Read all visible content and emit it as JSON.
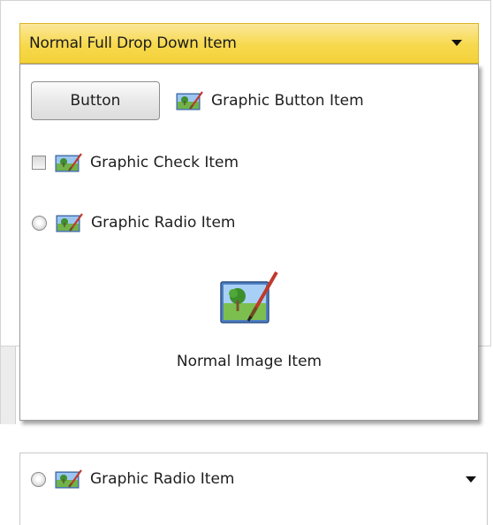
{
  "dropdown_top": {
    "label": "Normal Full Drop Down Item",
    "arrow_icon": "chevron-down-icon",
    "accent_color": "#f6d743"
  },
  "popup": {
    "button_label": "Button",
    "graphic_button_item": {
      "label": "Graphic Button Item",
      "icon": "image-paint-icon"
    },
    "graphic_check_item": {
      "label": "Graphic Check Item",
      "icon": "image-paint-icon",
      "checked": false
    },
    "graphic_radio_item": {
      "label": "Graphic Radio Item",
      "icon": "image-paint-icon",
      "selected": false
    },
    "normal_image_item": {
      "label": "Normal Image Item",
      "icon": "image-paint-icon"
    }
  },
  "dropdown_bottom": {
    "selected": {
      "label": "Graphic Radio Item",
      "icon": "image-paint-icon",
      "selected": false
    },
    "arrow_icon": "chevron-down-icon"
  }
}
